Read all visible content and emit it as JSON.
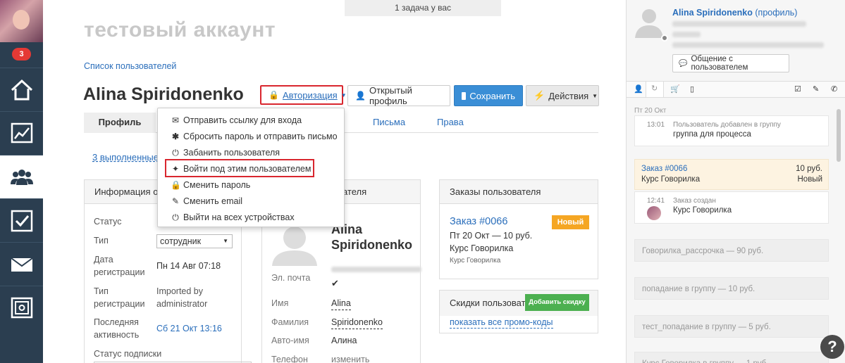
{
  "nav": {
    "badge": "3",
    "items": [
      "home-icon",
      "chart-icon",
      "users-icon",
      "tasks-icon",
      "mail-icon",
      "safe-icon"
    ],
    "accent": "#2b3e50"
  },
  "task_notice": "1 задача у вас",
  "page_title": "тестовый аккаунт",
  "breadcrumb": "Список пользователей",
  "user_name": "Alina Spiridonenko",
  "toolbar": {
    "auth": "Авторизация",
    "open_profile": "Открытый профиль",
    "save": "Сохранить",
    "actions": "Действия"
  },
  "tabs": {
    "profile": "Профиль",
    "letters": "Письма",
    "rights": "Права"
  },
  "completed_link": "3 выполненные",
  "dropdown": {
    "items": [
      {
        "icon": "envelope-icon",
        "label": "Отправить ссылку для входа"
      },
      {
        "icon": "asterisk-icon",
        "label": "Сбросить пароль и отправить письмо"
      },
      {
        "icon": "power-icon",
        "label": "Забанить пользователя"
      },
      {
        "icon": "login-as-icon",
        "label": "Войти под этим пользователем"
      },
      {
        "icon": "lock-icon",
        "label": "Сменить пароль"
      },
      {
        "icon": "edit-icon",
        "label": "Сменить email"
      },
      {
        "icon": "power-icon",
        "label": "Выйти на всех устройствах"
      }
    ]
  },
  "info_panel": {
    "title": "Информация о п",
    "status_label": "Статус",
    "type_label": "Тип",
    "type_value": "сотрудник",
    "reg_date_label_1": "Дата",
    "reg_date_label_2": "регистрации",
    "reg_date_value": "Пн 14 Авг 07:18",
    "reg_type_label_1": "Тип",
    "reg_type_label_2": "регистрации",
    "reg_type_value_1": "Imported by",
    "reg_type_value_2": "administrator",
    "last_active_label_1": "Последняя",
    "last_active_label_2": "активность",
    "last_active_value": "Сб 21 Окт 13:16",
    "subscription_label": "Статус подписки"
  },
  "user_panel": {
    "title": "ователя",
    "name_1": "Alina",
    "name_2": "Spiridonenko",
    "email_label": "Эл. почта",
    "first_name_label": "Имя",
    "first_name_value": "Alina",
    "last_name_label": "Фамилия",
    "last_name_value": "Spiridonenko",
    "auto_name_label": "Авто-имя",
    "auto_name_value": "Алина",
    "phone_label": "Телефон",
    "phone_value": "изменить"
  },
  "orders_panel": {
    "title": "Заказы пользователя",
    "order_link": "Заказ #0066",
    "order_status": "Новый",
    "order_meta": "Пт 20 Окт — 10 руб.",
    "order_course": "Курс Говорилка",
    "order_course_small": "Курс Говорилка"
  },
  "discounts_panel": {
    "title": "Скидки пользовате",
    "add_btn": "Добавить скидку",
    "promo_link": "показать все промо-коды"
  },
  "right_panel": {
    "name": "Alina Spiridonenko",
    "profile_link": "(профиль)",
    "chat_btn": "Общение с пользователем",
    "date_header": "Пт 20 Окт",
    "feed": [
      {
        "time": "13:01",
        "title": "Пользователь добавлен в группу",
        "text": "группа для процесса"
      },
      {
        "order": "Заказ #0066",
        "price": "10 руб.",
        "course": "Курс Говорилка",
        "status": "Новый"
      },
      {
        "time": "12:41",
        "title": "Заказ создан",
        "text": "Курс Говорилка"
      }
    ],
    "grey_items": [
      "Говорилка_рассрочка — 90 руб.",
      "попадание в группу — 10 руб.",
      "тест_попадание в группу — 5 руб.",
      "Курс Говорилка в группу — 1 руб."
    ]
  },
  "help": "?"
}
